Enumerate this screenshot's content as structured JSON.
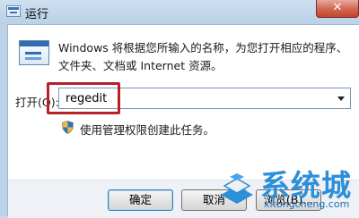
{
  "window": {
    "title": "运行",
    "close_label": "✕"
  },
  "dialog": {
    "description_line1": "Windows 将根据您所输入的名称，为您打开相应的程序、",
    "description_line2": "文件夹、文档或 Internet 资源。",
    "open_label": "打开(O):",
    "open_value": "regedit",
    "admin_note": "使用管理权限创建此任务。",
    "highlight_color": "#b8202a"
  },
  "buttons": {
    "ok": "确定",
    "cancel": "取消",
    "browse": "浏览(B)..."
  },
  "watermark": {
    "brand": "系统城",
    "url": "xitongcheng.com"
  },
  "colors": {
    "title_bg": "#bcd2e8",
    "close_red": "#c2442b",
    "brand_blue": "#2c8fd9"
  }
}
